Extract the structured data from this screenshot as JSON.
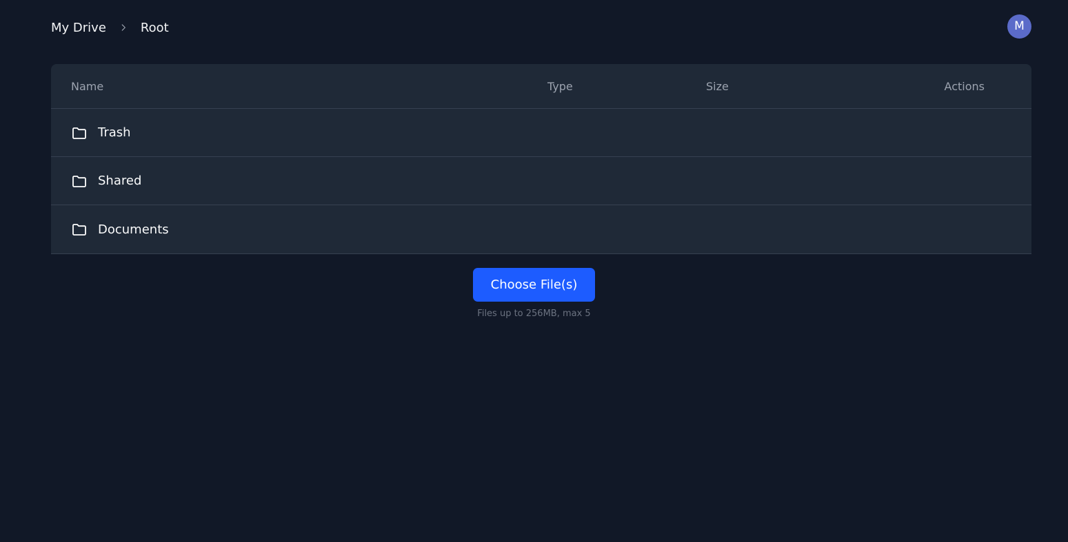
{
  "breadcrumb": {
    "items": [
      "My Drive",
      "Root"
    ]
  },
  "user": {
    "avatar_initial": "M"
  },
  "table": {
    "columns": {
      "name": "Name",
      "type": "Type",
      "size": "Size",
      "actions": "Actions"
    },
    "rows": [
      {
        "name": "Trash",
        "icon": "folder-icon"
      },
      {
        "name": "Shared",
        "icon": "folder-icon"
      },
      {
        "name": "Documents",
        "icon": "folder-icon"
      }
    ]
  },
  "upload": {
    "button_label": "Choose File(s)",
    "hint": "Files up to 256MB, max 5"
  },
  "colors": {
    "background": "#111827",
    "card": "#1f2937",
    "accent": "#1d5cff",
    "avatar": "#5b6bc9"
  }
}
